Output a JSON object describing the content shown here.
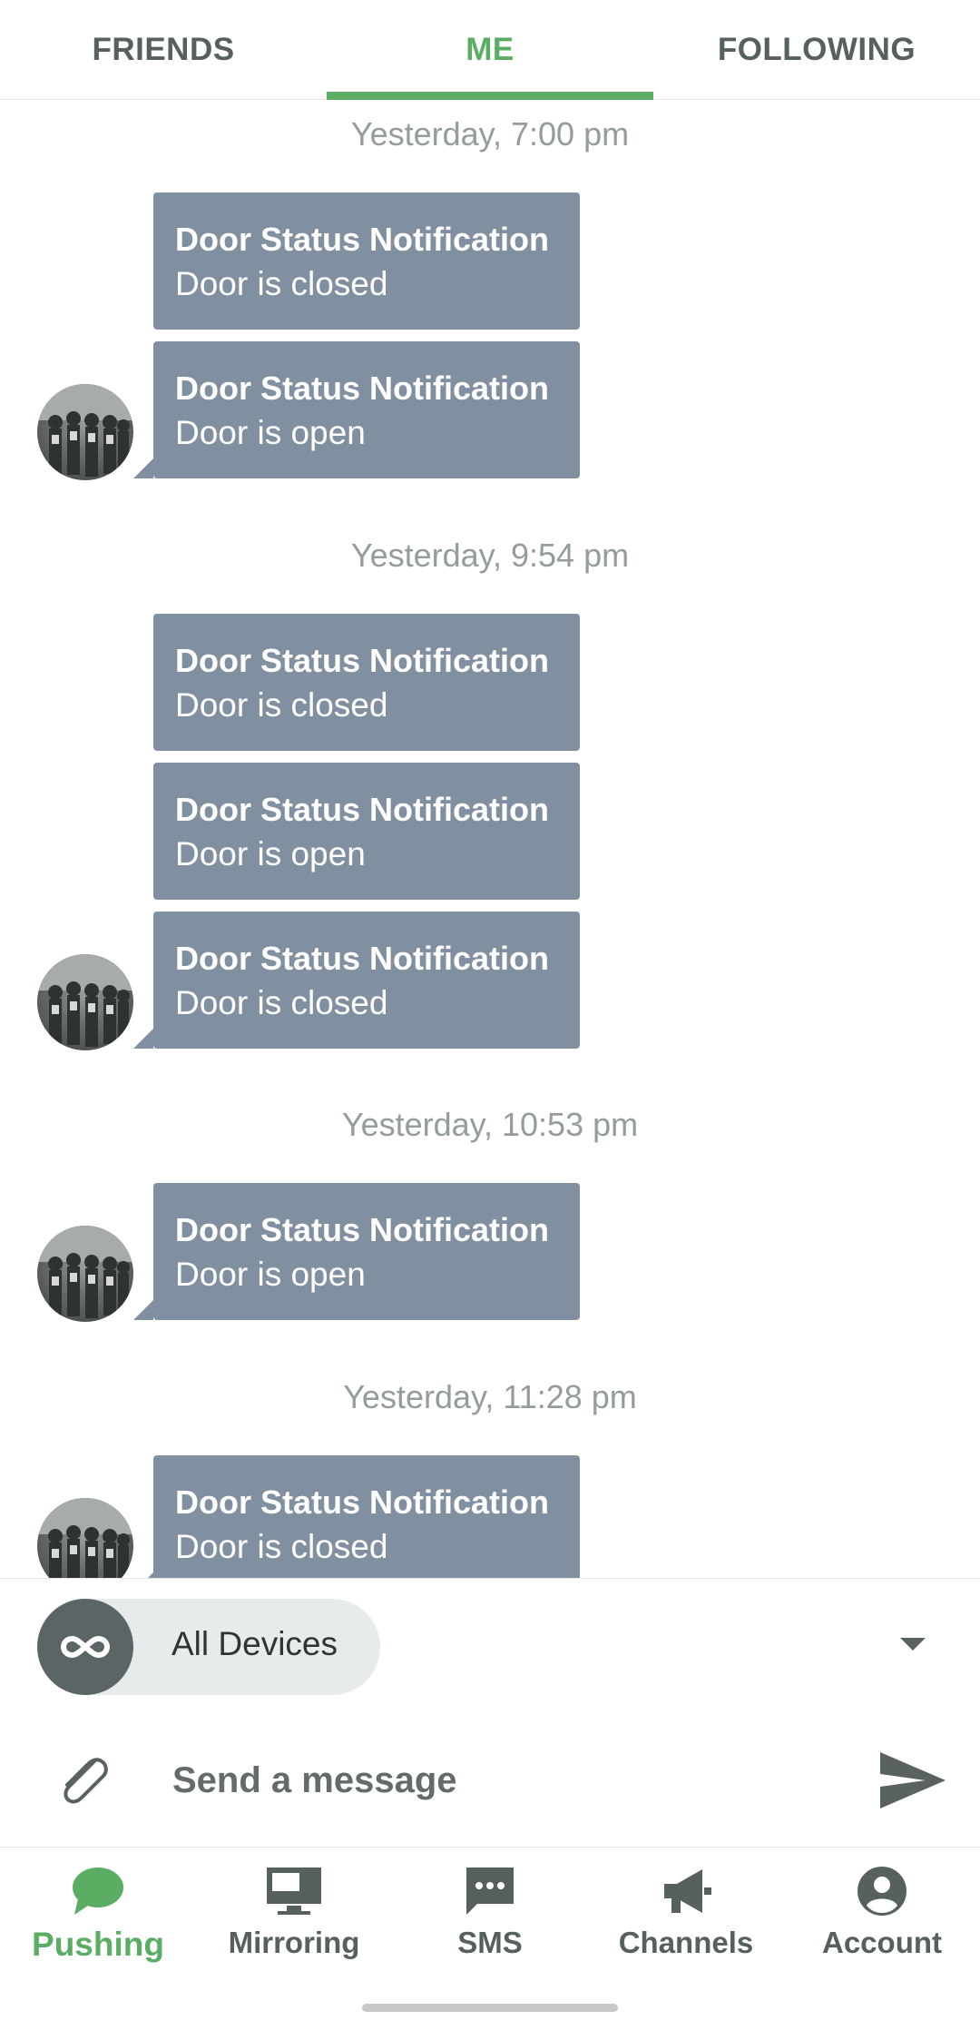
{
  "tabs": [
    {
      "label": "FRIENDS",
      "active": false
    },
    {
      "label": "ME",
      "active": true
    },
    {
      "label": "FOLLOWING",
      "active": false
    }
  ],
  "accent_color": "#5aad63",
  "bubble_color": "#8190a0",
  "message_groups": [
    {
      "time": "Yesterday, 7:00 pm",
      "messages": [
        {
          "title": "Door Status Notification",
          "body": "Door is closed"
        },
        {
          "title": "Door Status Notification",
          "body": "Door is open"
        }
      ]
    },
    {
      "time": "Yesterday, 9:54 pm",
      "messages": [
        {
          "title": "Door Status Notification",
          "body": "Door is closed"
        },
        {
          "title": "Door Status Notification",
          "body": "Door is open"
        },
        {
          "title": "Door Status Notification",
          "body": "Door is closed"
        }
      ]
    },
    {
      "time": "Yesterday, 10:53 pm",
      "messages": [
        {
          "title": "Door Status Notification",
          "body": "Door is open"
        }
      ]
    },
    {
      "time": "Yesterday, 11:28 pm",
      "messages": [
        {
          "title": "Door Status Notification",
          "body": "Door is closed"
        }
      ]
    }
  ],
  "device_selector": {
    "label": "All Devices",
    "icon": "infinity-icon"
  },
  "compose": {
    "placeholder": "Send a message",
    "attach_icon": "paperclip-icon",
    "send_icon": "send-icon"
  },
  "bottom_nav": [
    {
      "label": "Pushing",
      "icon": "chat-bubble-icon",
      "active": true
    },
    {
      "label": "Mirroring",
      "icon": "monitor-icon",
      "active": false
    },
    {
      "label": "SMS",
      "icon": "sms-icon",
      "active": false
    },
    {
      "label": "Channels",
      "icon": "megaphone-icon",
      "active": false
    },
    {
      "label": "Account",
      "icon": "account-icon",
      "active": false
    }
  ]
}
